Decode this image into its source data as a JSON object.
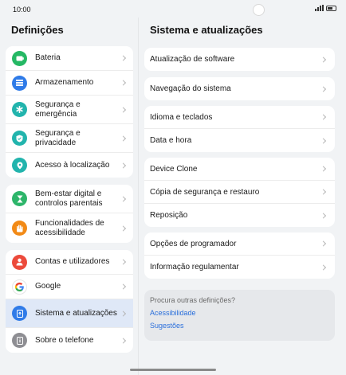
{
  "status_bar": {
    "time": "10:00"
  },
  "left": {
    "title": "Definições",
    "groups": [
      [
        {
          "label": "Bateria",
          "icon": "battery-icon",
          "color": "#25b864"
        },
        {
          "label": "Armazenamento",
          "icon": "storage-icon",
          "color": "#2f7be8"
        },
        {
          "label": "Segurança e emergência",
          "icon": "emergency-icon",
          "color": "#22b4ad"
        },
        {
          "label": "Segurança e privacidade",
          "icon": "shield-icon",
          "color": "#22b4ad"
        },
        {
          "label": "Acesso à localização",
          "icon": "location-icon",
          "color": "#22b4ad"
        }
      ],
      [
        {
          "label": "Bem-estar digital e controlos parentais",
          "icon": "hourglass-icon",
          "color": "#2db56a"
        },
        {
          "label": "Funcionalidades de acessibilidade",
          "icon": "hand-icon",
          "color": "#f28a16"
        }
      ],
      [
        {
          "label": "Contas e utilizadores",
          "icon": "user-icon",
          "color": "#ec4a3b"
        },
        {
          "label": "Google",
          "icon": "google-icon",
          "color": "#ffffff"
        },
        {
          "label": "Sistema e atualizações",
          "icon": "system-update-icon",
          "color": "#2f7be8"
        },
        {
          "label": "Sobre o telefone",
          "icon": "phone-info-icon",
          "color": "#8e8e93"
        }
      ]
    ]
  },
  "right": {
    "title": "Sistema e atualizações",
    "groups": [
      [
        "Atualização de software"
      ],
      [
        "Navegação do sistema"
      ],
      [
        "Idioma e teclados",
        "Data e hora"
      ],
      [
        "Device Clone",
        "Cópia de segurança e restauro",
        "Reposição"
      ],
      [
        "Opções de programador",
        "Informação regulamentar"
      ]
    ],
    "suggestions": {
      "question": "Procura outras definições?",
      "links": [
        "Acessibilidade",
        "Sugestões"
      ]
    }
  }
}
